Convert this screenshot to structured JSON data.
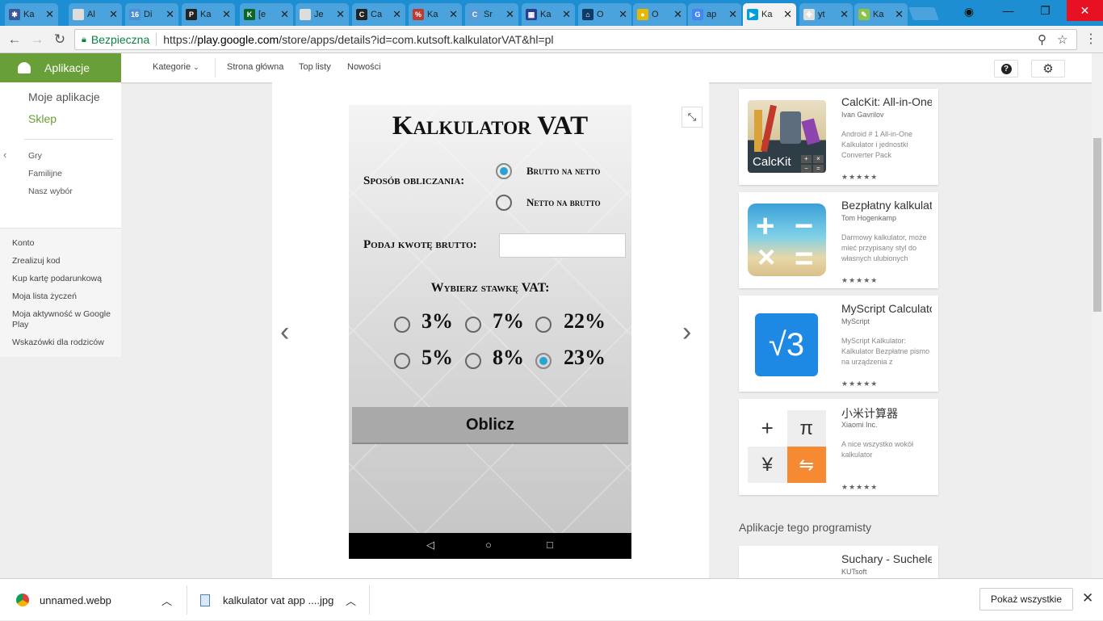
{
  "tabs": [
    {
      "title": "Ka",
      "color": "#3b5998",
      "icon": "✱"
    },
    {
      "title": "Al",
      "color": "#dddddd",
      "icon": ""
    },
    {
      "title": "Di",
      "color": "#4a90d9",
      "icon": "16"
    },
    {
      "title": "Ka",
      "color": "#222222",
      "icon": "P"
    },
    {
      "title": "[e",
      "color": "#0b6623",
      "icon": "K"
    },
    {
      "title": "Je",
      "color": "#dddddd",
      "icon": ""
    },
    {
      "title": "Ca",
      "color": "#222222",
      "icon": "C"
    },
    {
      "title": "Ka",
      "color": "#c0392b",
      "icon": "%"
    },
    {
      "title": "Śr",
      "color": "#5b9bd5",
      "icon": "C"
    },
    {
      "title": "Ka",
      "color": "#2c3e8f",
      "icon": "▦"
    },
    {
      "title": "O",
      "color": "#0d3b66",
      "icon": "⌂"
    },
    {
      "title": "O",
      "color": "#e6b800",
      "icon": "●"
    },
    {
      "title": "ap",
      "color": "#4285f4",
      "icon": "G"
    },
    {
      "title": "Ka",
      "color": "#00a0e0",
      "icon": "▶"
    },
    {
      "title": "yt",
      "color": "#e0e0e0",
      "icon": "✤"
    },
    {
      "title": "Ka",
      "color": "#8bc34a",
      "icon": "✎"
    }
  ],
  "tab_close": "✕",
  "address": {
    "secure_label": "Bezpieczna",
    "scheme": "https://",
    "host": "play.google.com",
    "path": "/store/apps/details?id=com.kutsoft.kalkulatorVAT&hl=pl"
  },
  "header": {
    "apps_label": "Aplikacje",
    "categories": "Kategorie",
    "nav": [
      "Strona główna",
      "Top listy",
      "Nowości"
    ]
  },
  "sidebar": {
    "my_apps": "Moje aplikacje",
    "store": "Sklep",
    "sub": [
      "Gry",
      "Familijne",
      "Nasz wybór"
    ]
  },
  "links": [
    "Konto",
    "Zrealizuj kod",
    "Kup kartę podarunkową",
    "Moja lista życzeń",
    "Moja aktywność w Google Play",
    "Wskazówki dla rodziców"
  ],
  "app": {
    "title": "Kalkulator VAT",
    "method_label": "Sposób obliczania:",
    "opt1": "Brutto na netto",
    "opt2": "Netto na brutto",
    "amount_label": "Podaj kwotę brutto:",
    "rate_label": "Wybierz stawkę VAT:",
    "rates": [
      "3%",
      "7%",
      "22%",
      "5%",
      "8%",
      "23%"
    ],
    "selected_rate": "23%",
    "selected_method": "Brutto na netto",
    "button": "Oblicz"
  },
  "cards": [
    {
      "title": "CalcKit: All-in-One",
      "dev": "Ivan Gavrilov",
      "desc": "Android # 1 All-in-One Kalkulator i jednostki Converter Pack",
      "stars": "★★★★★",
      "rating": 5
    },
    {
      "title": "Bezpłatny kalkulator",
      "dev": "Tom Hogenkamp",
      "desc": "Darmowy kalkulator, może mieć przypisany styl do własnych ulubionych",
      "stars": "★★★★★",
      "rating": 4.5
    },
    {
      "title": "MyScript Calculator",
      "dev": "MyScript",
      "desc": "MyScript Kalkulator: Kalkulator Bezpłatne pismo na urządzenia z",
      "stars": "★★★★★",
      "rating": 4.5
    },
    {
      "title": "小米计算器",
      "dev": "Xiaomi Inc.",
      "desc": "A nice wszystko wokół kalkulator",
      "stars": "★★★★★",
      "rating": 4.5
    }
  ],
  "calckit_icon_label": "CalcKit",
  "dev_section": "Aplikacje tego programisty",
  "dev_card": {
    "title": "Suchary - Suchele",
    "dev": "KUTsoft"
  },
  "downloads": [
    {
      "name": "unnamed.webp"
    },
    {
      "name": "kalkulator vat app ....jpg"
    }
  ],
  "show_all": "Pokaż wszystkie"
}
